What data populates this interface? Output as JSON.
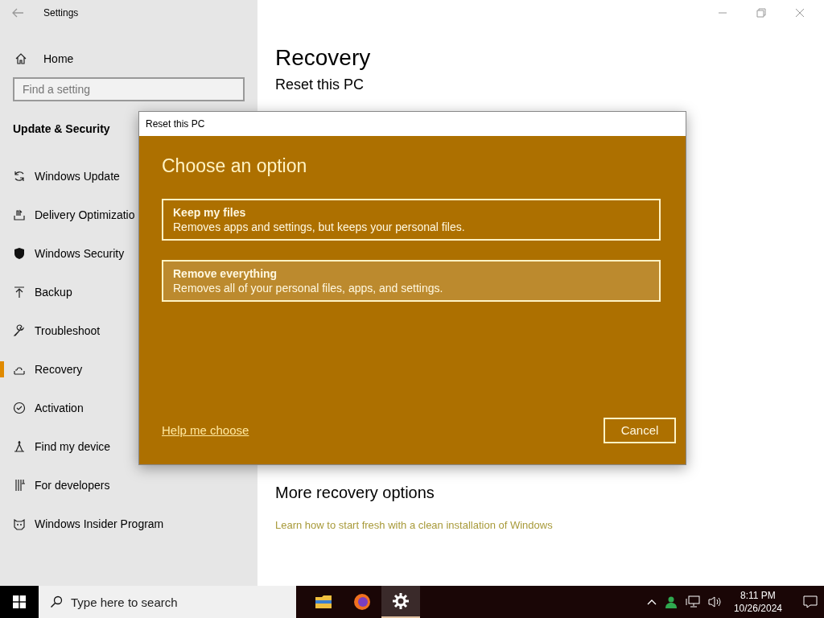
{
  "window": {
    "title": "Settings"
  },
  "sidebar": {
    "home": "Home",
    "search": {
      "placeholder": "Find a setting"
    },
    "section": "Update & Security",
    "items": [
      {
        "label": "Windows Update",
        "selected": false
      },
      {
        "label": "Delivery Optimizatio",
        "selected": false
      },
      {
        "label": "Windows Security",
        "selected": false
      },
      {
        "label": "Backup",
        "selected": false
      },
      {
        "label": "Troubleshoot",
        "selected": false
      },
      {
        "label": "Recovery",
        "selected": true
      },
      {
        "label": "Activation",
        "selected": false
      },
      {
        "label": "Find my device",
        "selected": false
      },
      {
        "label": "For developers",
        "selected": false
      },
      {
        "label": "Windows Insider Program",
        "selected": false
      }
    ]
  },
  "page": {
    "title": "Recovery",
    "heading": "Reset this PC",
    "more_heading": "More recovery options",
    "link": "Learn how to start fresh with a clean installation of Windows"
  },
  "dialog": {
    "title": "Reset this PC",
    "heading": "Choose an option",
    "options": [
      {
        "title": "Keep my files",
        "description": "Removes apps and settings, but keeps your personal files.",
        "hovered": false
      },
      {
        "title": "Remove everything",
        "description": "Removes all of your personal files, apps, and settings.",
        "hovered": true
      }
    ],
    "help_link": "Help me choose",
    "cancel": "Cancel"
  },
  "taskbar": {
    "search": {
      "placeholder": "Type here to search"
    },
    "apps": [
      {
        "kind": "folder",
        "selected": false
      },
      {
        "kind": "browser",
        "selected": false
      },
      {
        "kind": "settings",
        "selected": true
      }
    ],
    "clock": {
      "time": "8:11 PM",
      "date": "10/26/2024"
    }
  }
}
